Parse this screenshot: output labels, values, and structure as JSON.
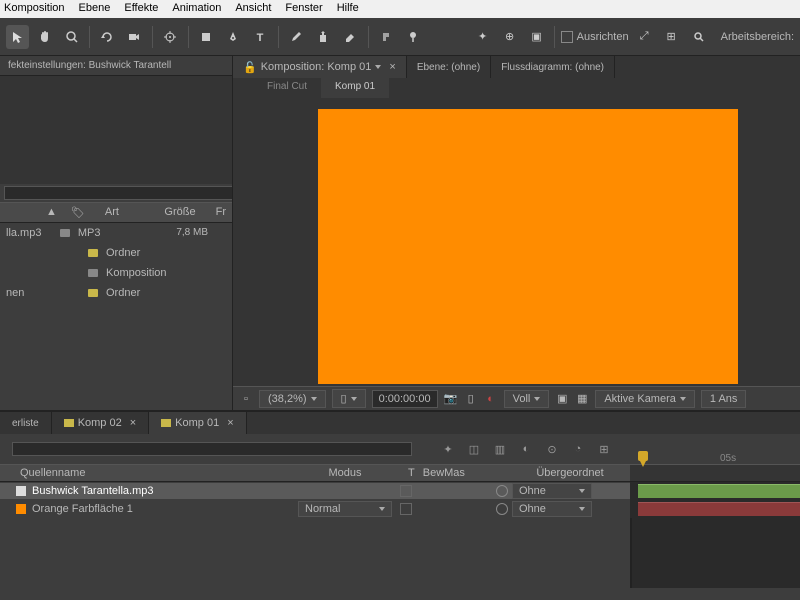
{
  "menu": [
    "Komposition",
    "Ebene",
    "Effekte",
    "Animation",
    "Ansicht",
    "Fenster",
    "Hilfe"
  ],
  "toolbar": {
    "ausrichten": "Ausrichten",
    "arbeitsbereich": "Arbeitsbereich:"
  },
  "effects_panel": {
    "title": "fekteinstellungen: Bushwick Tarantell"
  },
  "project": {
    "headers": {
      "name_sort": "▲",
      "art": "Art",
      "groesse": "Größe",
      "fr": "Fr"
    },
    "rows": [
      {
        "name": "lla.mp3",
        "type": "MP3",
        "size": "7,8 MB",
        "icon": "gray"
      },
      {
        "name": "",
        "type": "Ordner",
        "size": "",
        "icon": "yellow"
      },
      {
        "name": "",
        "type": "Komposition",
        "size": "",
        "icon": "gray"
      },
      {
        "name": "nen",
        "type": "Ordner",
        "size": "",
        "icon": "yellow"
      }
    ]
  },
  "viewer": {
    "tabs": [
      {
        "label": "Komposition: Komp 01",
        "active": true
      },
      {
        "label": "Ebene: (ohne)",
        "active": false
      },
      {
        "label": "Flussdiagramm: (ohne)",
        "active": false
      }
    ],
    "subtabs": [
      {
        "label": "Final Cut",
        "active": false
      },
      {
        "label": "Komp 01",
        "active": true
      }
    ],
    "controls": {
      "zoom": "(38,2%)",
      "ratio": "▯",
      "time": "0:00:00:00",
      "quality": "Voll",
      "camera": "Aktive Kamera",
      "views": "1 Ans"
    }
  },
  "timeline": {
    "tabs": [
      {
        "label": "erliste",
        "active": false,
        "icon": false
      },
      {
        "label": "Komp 02",
        "active": false,
        "icon": true
      },
      {
        "label": "Komp 01",
        "active": true,
        "icon": true
      }
    ],
    "time_tick": "05s",
    "columns": {
      "quellenname": "Quellenname",
      "modus": "Modus",
      "t": "T",
      "bewmas": "BewMas",
      "parent": "Übergeordnet"
    },
    "layers": [
      {
        "name": "Bushwick Tarantella.mp3",
        "mode": "",
        "parent": "Ohne",
        "icon": "audio",
        "bar": "green",
        "selected": true
      },
      {
        "name": "Orange Farbfläche 1",
        "mode": "Normal",
        "parent": "Ohne",
        "icon": "solid",
        "bar": "red",
        "selected": false
      }
    ]
  }
}
